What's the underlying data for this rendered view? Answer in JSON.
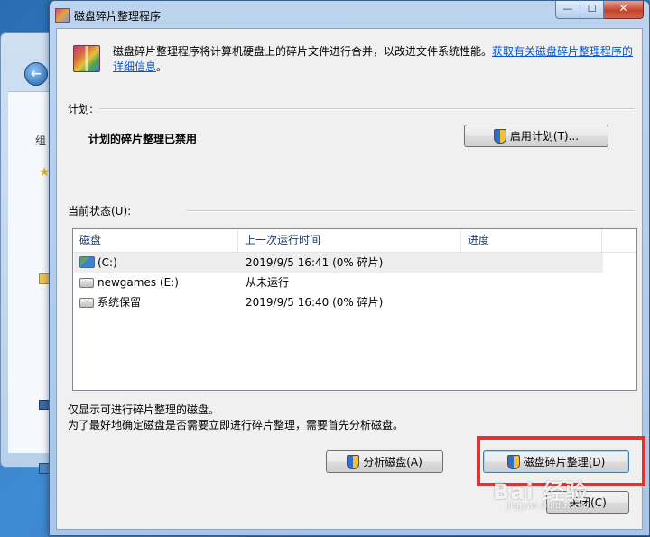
{
  "window": {
    "title": "磁盘碎片整理程序",
    "minimize_glyph": "—",
    "maximize_glyph": "☐",
    "close_glyph": "✕"
  },
  "description": {
    "text": "磁盘碎片整理程序将计算机硬盘上的碎片文件进行合并，以改进文件系统性能。",
    "link_text": "获取有关磁盘碎片整理程序的详细信息",
    "trailing": "。"
  },
  "schedule": {
    "label": "计划:",
    "status": "计划的碎片整理已禁用",
    "enable_button": "启用计划(T)..."
  },
  "current_status": {
    "label": "当前状态(U):",
    "columns": [
      "磁盘",
      "上一次运行时间",
      "进度"
    ],
    "rows": [
      {
        "disk": "(C:)",
        "last_run": "2019/9/5 16:41 (0% 碎片)",
        "progress": "",
        "icon": "system-drive-icon"
      },
      {
        "disk": "newgames (E:)",
        "last_run": "从未运行",
        "progress": "",
        "icon": "drive-icon"
      },
      {
        "disk": "系统保留",
        "last_run": "2019/9/5 16:40 (0% 碎片)",
        "progress": "",
        "icon": "drive-icon"
      }
    ]
  },
  "notes": {
    "line1": "仅显示可进行碎片整理的磁盘。",
    "line2": "为了最好地确定磁盘是否需要立即进行碎片整理，需要首先分析磁盘。"
  },
  "buttons": {
    "analyze": "分析磁盘(A)",
    "defrag": "磁盘碎片整理(D)",
    "close": "关闭(C)"
  },
  "background": {
    "back_glyph": "←",
    "nav_fragment": "组"
  },
  "watermark": {
    "brand": "Bai 经验",
    "url": "jingyan.baidu.com"
  },
  "colors": {
    "link": "#0a56c9",
    "highlight_box": "#e8312e"
  }
}
